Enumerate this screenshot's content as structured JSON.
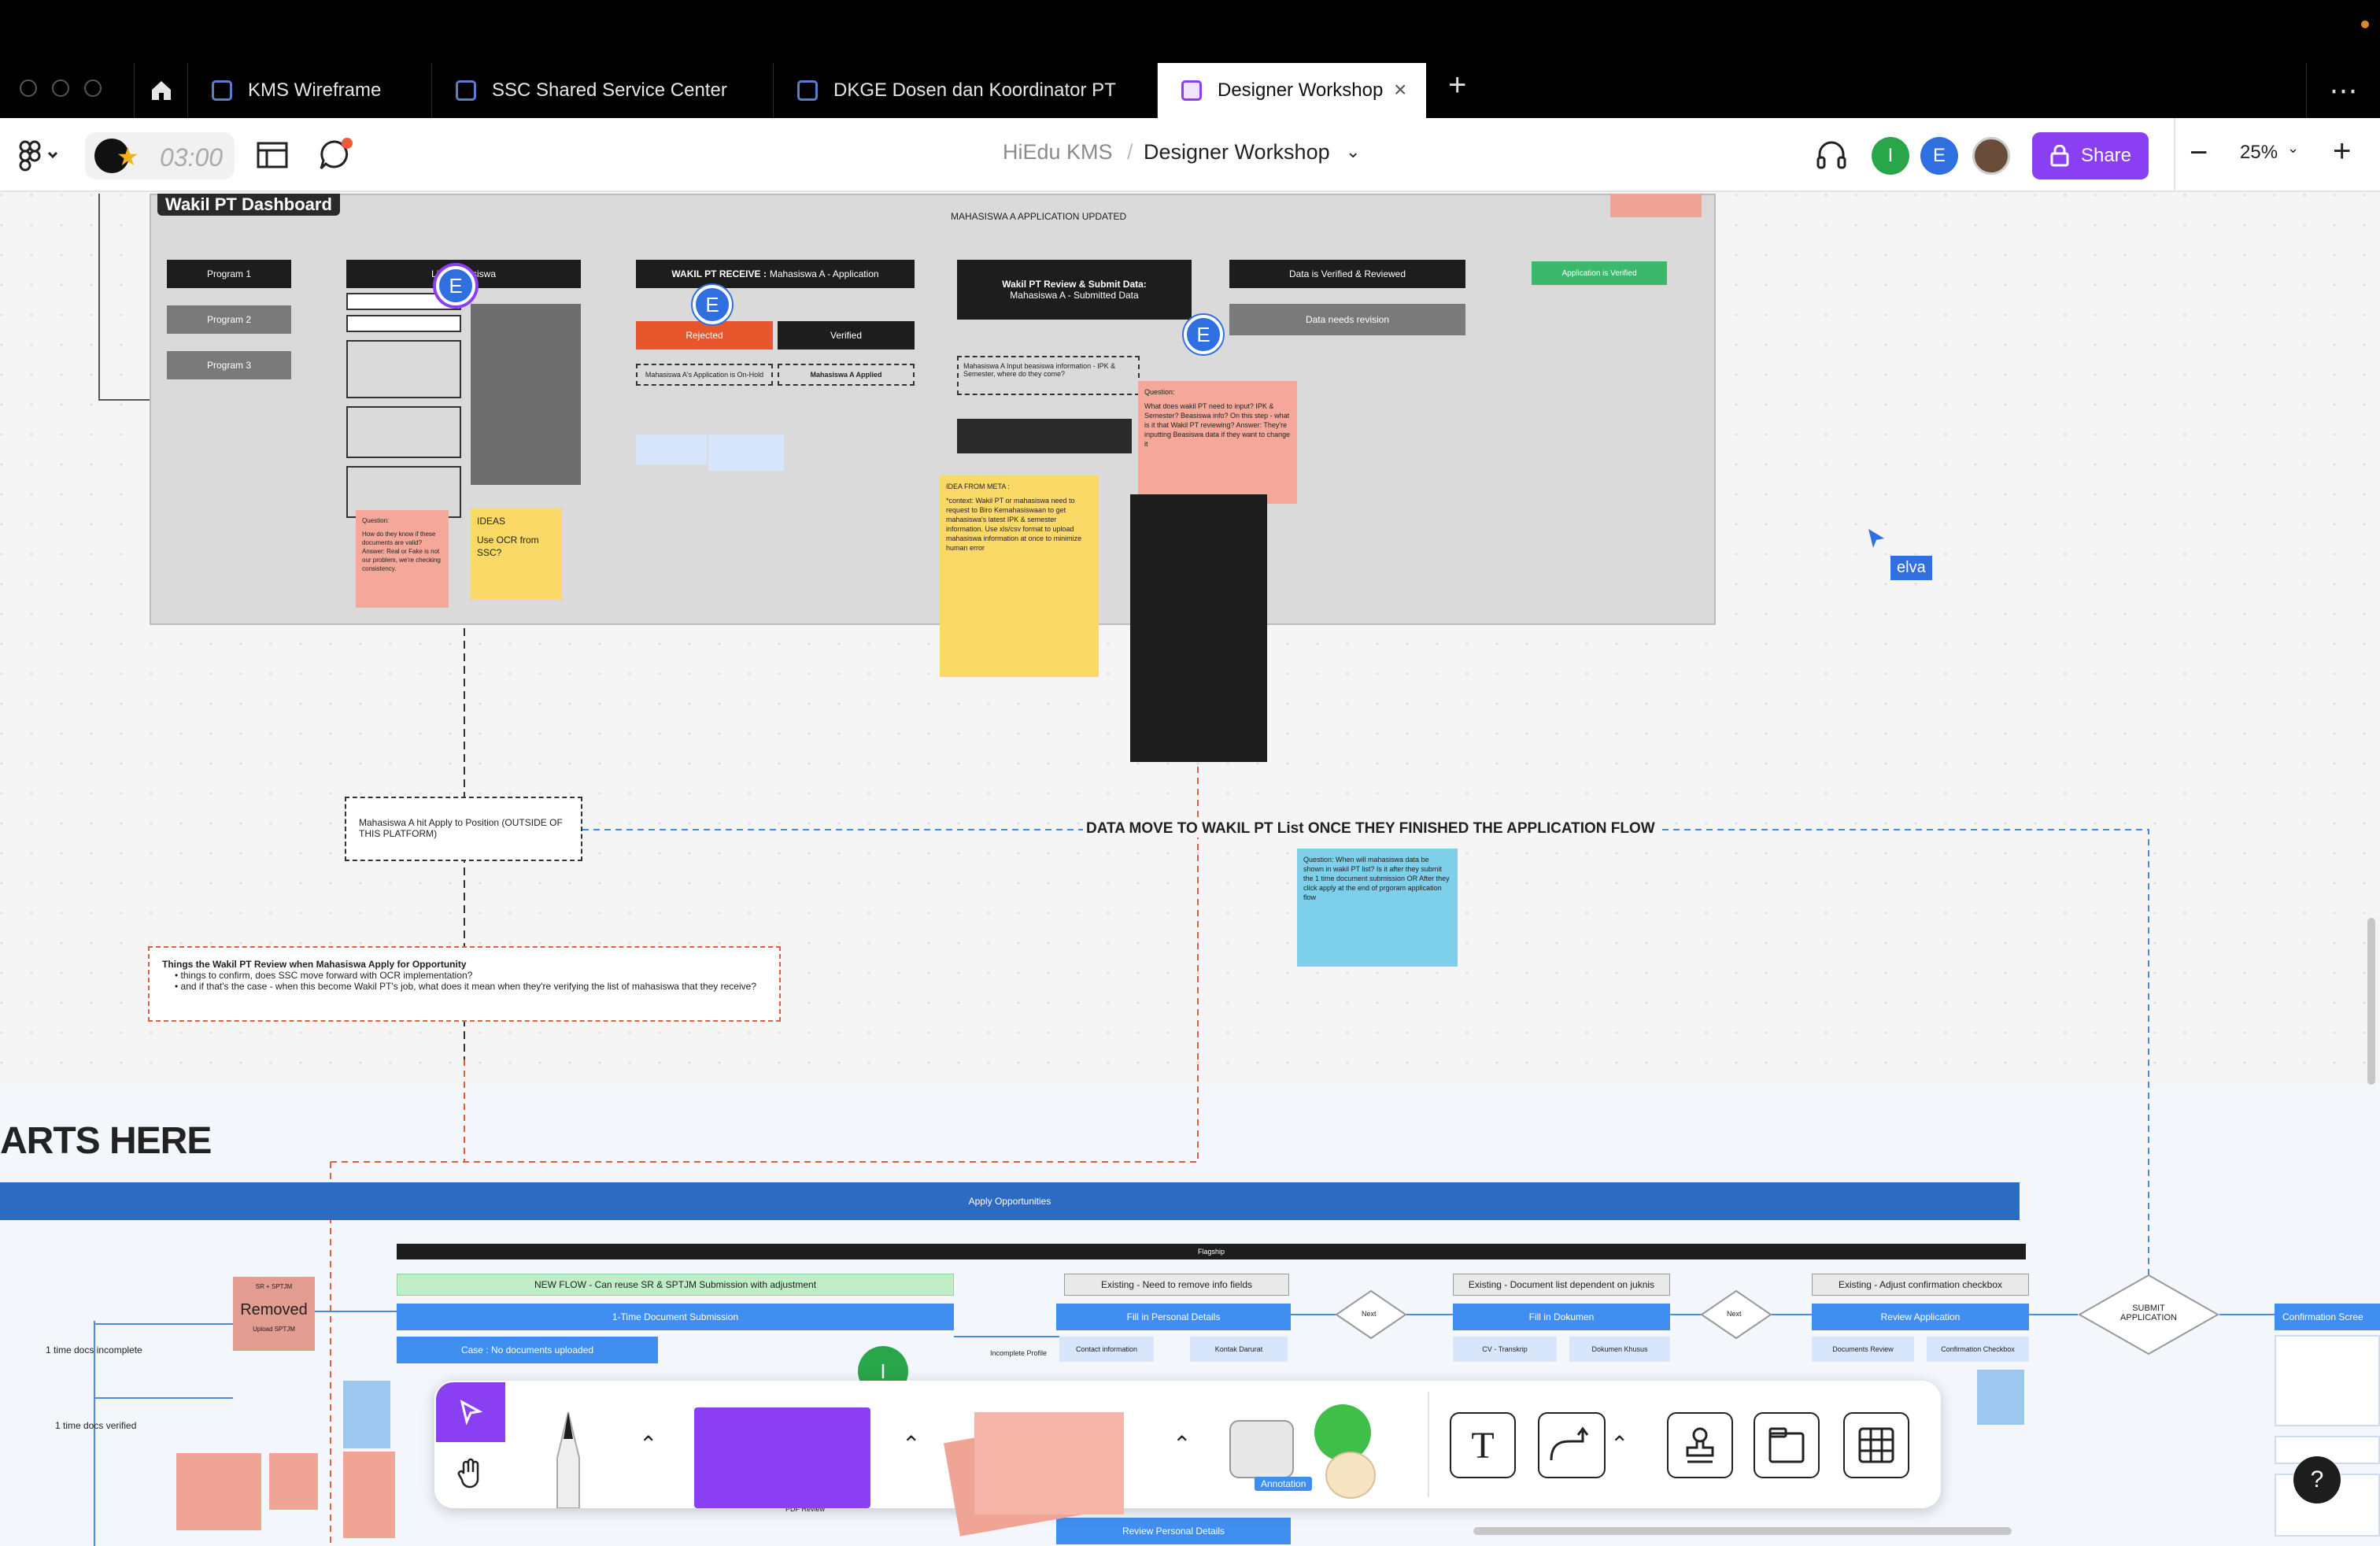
{
  "tabs": [
    {
      "label": "KMS Wireframe"
    },
    {
      "label": "SSC Shared Service Center"
    },
    {
      "label": "DKGE Dosen dan Koordinator PT"
    },
    {
      "label": "Designer Workshop",
      "active": true
    }
  ],
  "toolbar": {
    "timer": "03:00",
    "breadcrumb_project": "HiEdu KMS",
    "breadcrumb_separator": "/",
    "file_name": "Designer Workshop",
    "avatars": [
      "I",
      "E"
    ],
    "share_label": "Share",
    "zoom": "25%"
  },
  "colors": {
    "accent": "#8a3ff2",
    "avatar_green": "#2aa64a",
    "avatar_blue": "#2f6fe0",
    "dark_node": "#1d1d1d",
    "flow_blue": "#3f8ef0",
    "apply_bar": "#2d6bc2"
  },
  "board": {
    "section_title": "Wakil PT Dashboard",
    "updated_label": "MAHASISWA A APPLICATION UPDATED",
    "programs": [
      "Program 1",
      "Program 2",
      "Program 3"
    ],
    "list_node": "List Mahasiswa",
    "receive_node_bold": "WAKIL PT RECEIVE :",
    "receive_node_rest": "Mahasiswa A - Application",
    "rejected": "Rejected",
    "verified": "Verified",
    "on_hold": "Mahasiswa A's Application is On-Hold",
    "applied": "Mahasiswa A Applied",
    "review_bold": "Wakil PT Review & Submit Data:",
    "review_rest": "Mahasiswa A - Submitted Data",
    "data_verified": "Data is Verified & Reviewed",
    "needs_revision": "Data needs revision",
    "app_verified": "Application is Verified",
    "input_text": "Mahasiswa A Input beasiswa information - IPK & Semester, where do they come?",
    "ideas_title": "IDEAS",
    "ideas_body": "Use OCR from SSC?",
    "question_title": "Question:",
    "question_body": "What does wakil PT need to input? IPK & Semester? Beasiswa info? On this step - what is it that Wakil PT reviewing? Answer: They're inputting Beasiswa data if they want to change it",
    "idea_meta_title": "IDEA FROM META :",
    "idea_meta_body": "*context: Wakil PT or mahasiswa need to request to Biro Kemahasiswaan to get mahasiswa's latest IPK & semester information. Use xls/csv format to upload mahasiswa information at once to minimize human error",
    "question2_body": "How do they know if these documents are valid? Answer: Real or Fake is not our problem, we're checking consistency.",
    "apply_position": "Mahasiswa A hit Apply to Position (OUTSIDE OF THIS PLATFORM)",
    "data_move": "DATA MOVE TO WAKIL PT List ONCE THEY FINISHED THE APPLICATION FLOW",
    "question3_body": "Question: When will mahasiswa data be shown in wakil PT list? Is it after they submit the 1 time document submission OR After they click apply at the end of prgoram application flow",
    "things_title": "Things the Wakil PT Review when Mahasiswa Apply for Opportunity",
    "things_items": [
      "things to confirm, does SSC move forward with OCR implementation?",
      "and if that's the case - when this become Wakil PT's job, what does it mean when they're verifying the list of mahasiswa that they receive?"
    ],
    "cursor_label": "elva",
    "starts_here": "ARTS HERE",
    "apply_bar": "Apply Opportunities",
    "flagship": "Flagship",
    "new_flow": "NEW FLOW - Can reuse SR & SPTJM Submission with adjustment",
    "one_time": "1-Time Document Submission",
    "case_none": "Case : No documents uploaded",
    "removed": "Removed",
    "sr_sptjm": "SR + SPTJM",
    "upload_sptjm": "Upload SPTJM",
    "incomplete": "1 time docs incomplete",
    "verified_docs": "1 time docs verified",
    "existing_remove": "Existing - Need to remove info fields",
    "fill_personal": "Fill in Personal Details",
    "contact_info": "Contact information",
    "kontak_darurat": "Kontak Darurat",
    "incomplete_profile": "Incomplete Profile",
    "next": "Next",
    "existing_doc": "Existing - Document list dependent on juknis",
    "fill_dokumen": "Fill in Dokumen",
    "cv": "CV - Transkrip",
    "dokumen_khusus": "Dokumen Khusus",
    "existing_adjust": "Existing - Adjust confirmation checkbox",
    "review_app": "Review Application",
    "documents_review": "Documents Review",
    "confirmation_checkbox": "Confirmation Checkbox",
    "submit_app": "SUBMIT APPLICATION",
    "confirmation_screen": "Confirmation Scree",
    "review_personal": "Review Personal Details",
    "pdf_review": "PDF Review",
    "annotation": "Annotation"
  }
}
